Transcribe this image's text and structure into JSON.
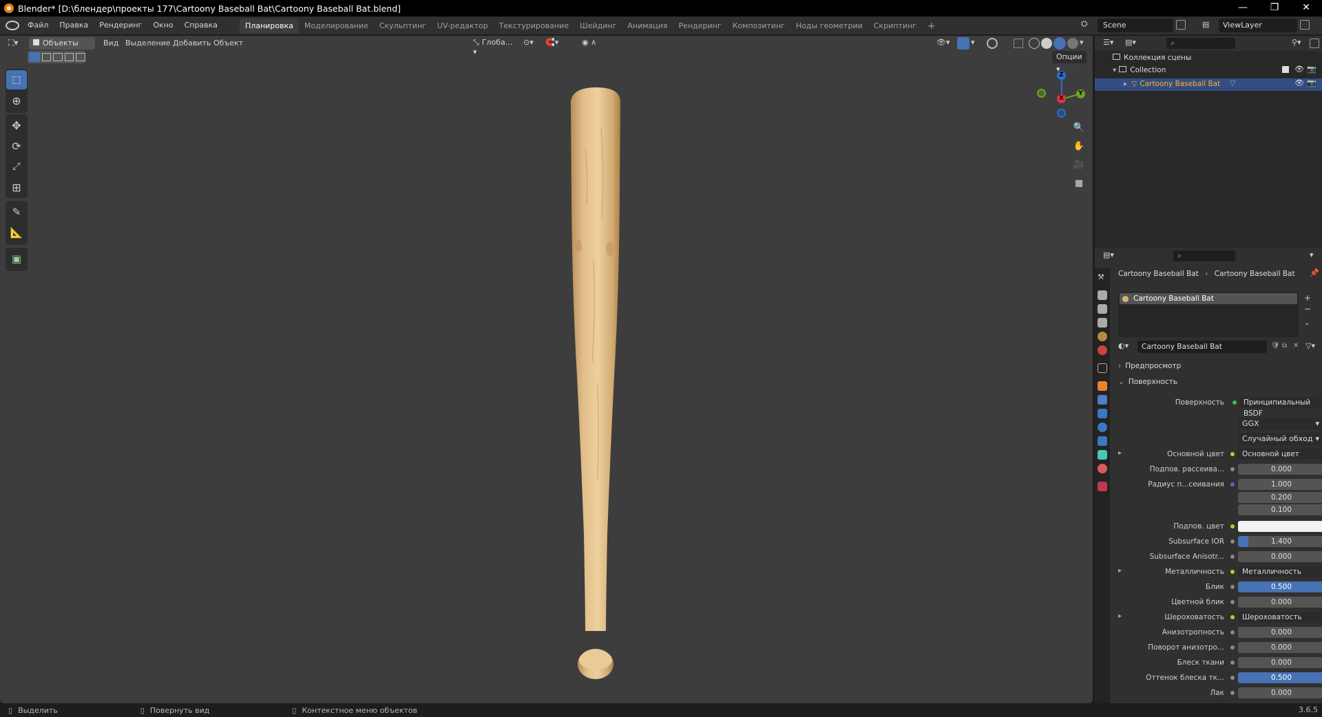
{
  "window": {
    "title": "Blender* [D:\\блендер\\проекты 177\\Cartoony Baseball Bat\\Cartoony Baseball Bat.blend]",
    "minimize": "—",
    "maximize": "❐",
    "close": "✕"
  },
  "menu": [
    "Файл",
    "Правка",
    "Рендеринг",
    "Окно",
    "Справка"
  ],
  "workspaces": [
    "Планировка",
    "Моделирование",
    "Скульптинг",
    "UV-редактор",
    "Текстурирование",
    "Шейдинг",
    "Анимация",
    "Рендеринг",
    "Композитинг",
    "Ноды геометрии",
    "Скриптинг",
    "+"
  ],
  "active_workspace": "Планировка",
  "scene": {
    "name": "Scene",
    "view_layer": "ViewLayer"
  },
  "viewport": {
    "mode": "Объекты",
    "menu": [
      "Вид",
      "Выделение",
      "Добавить",
      "Объект"
    ],
    "orientation": "Глоба...",
    "options": "Опции",
    "gizmo": {
      "x": "X",
      "y": "Y",
      "z": "Z"
    }
  },
  "outliner": {
    "scene_collection": "Коллекция сцены",
    "collection": "Collection",
    "object": "Cartoony Baseball Bat"
  },
  "properties": {
    "breadcrumb": [
      "Cartoony Baseball Bat",
      "Cartoony Baseball Bat"
    ],
    "slot": "Cartoony Baseball Bat",
    "material_name": "Cartoony Baseball Bat",
    "sections": {
      "preview": "Предпросмотр",
      "surface": "Поверхность"
    },
    "surface_label": "Поверхность",
    "surface_value": "Принципиальный BSDF",
    "distribution": "GGX",
    "subsurface_method": "Случайный обход",
    "rows": [
      {
        "label": "Основной цвет",
        "value": "Основной цвет",
        "type": "link",
        "expand": "▸"
      },
      {
        "label": "Подпов. рассеива...",
        "value": "0.000",
        "type": "num"
      },
      {
        "label": "Радиус п...сеивания",
        "value": "1.000",
        "type": "num"
      },
      {
        "label": "",
        "value": "0.200",
        "type": "num"
      },
      {
        "label": "",
        "value": "0.100",
        "type": "num"
      },
      {
        "label": "Подпов. цвет",
        "value": "",
        "type": "color"
      },
      {
        "label": "Subsurface IOR",
        "value": "1.400",
        "type": "num"
      },
      {
        "label": "Subsurface Anisotr...",
        "value": "0.000",
        "type": "num"
      },
      {
        "label": "Металличность",
        "value": "Металличность",
        "type": "link",
        "expand": "▸"
      },
      {
        "label": "Блик",
        "value": "0.500",
        "type": "blue"
      },
      {
        "label": "Цветной блик",
        "value": "0.000",
        "type": "num"
      },
      {
        "label": "Шероховатость",
        "value": "Шероховатость",
        "type": "link",
        "expand": "▸"
      },
      {
        "label": "Анизотропность",
        "value": "0.000",
        "type": "num"
      },
      {
        "label": "Поворот анизотро...",
        "value": "0.000",
        "type": "num"
      },
      {
        "label": "Блеск ткани",
        "value": "0.000",
        "type": "num"
      },
      {
        "label": "Оттенок блеска тк...",
        "value": "0.500",
        "type": "blue"
      },
      {
        "label": "Лак",
        "value": "0.000",
        "type": "num"
      }
    ],
    "subsurface_ior_fill": 0.12
  },
  "statusbar": {
    "select": "Выделить",
    "rotate": "Повернуть вид",
    "context": "Контекстное меню объектов",
    "version": "3.6.5"
  }
}
